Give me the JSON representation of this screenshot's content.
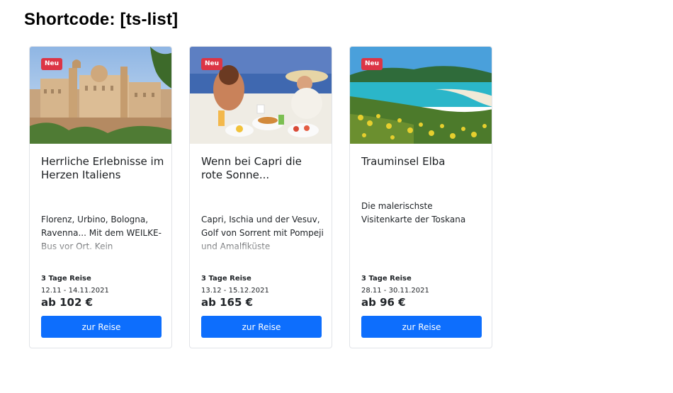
{
  "page": {
    "title": "Shortcode: [ts-list]"
  },
  "cards": [
    {
      "badge": "Neu",
      "title": "Herrliche Erlebnisse im Herzen Italiens",
      "description": "Florenz, Urbino, Bologna, Ravenna... Mit dem WEILKE-Bus vor Ort. Kein",
      "duration": "3 Tage Reise",
      "dates": "12.11 - 14.11.2021",
      "price": "ab 102 €",
      "button_label": "zur Reise"
    },
    {
      "badge": "Neu",
      "title": "Wenn bei Capri die rote Sonne...",
      "description": "Capri, Ischia und der Vesuv, Golf von Sorrent mit Pompeji und Amalfiküste",
      "duration": "3 Tage Reise",
      "dates": "13.12 - 15.12.2021",
      "price": "ab 165 €",
      "button_label": "zur Reise"
    },
    {
      "badge": "Neu",
      "title": "Trauminsel Elba",
      "description": "Die malerischste Visitenkarte der Toskana",
      "duration": "3 Tage Reise",
      "dates": "28.11 - 30.11.2021",
      "price": "ab 96 €",
      "button_label": "zur Reise"
    }
  ],
  "colors": {
    "badge": "#dc3545",
    "button": "#0d6efd",
    "border": "#e2e4e8"
  }
}
